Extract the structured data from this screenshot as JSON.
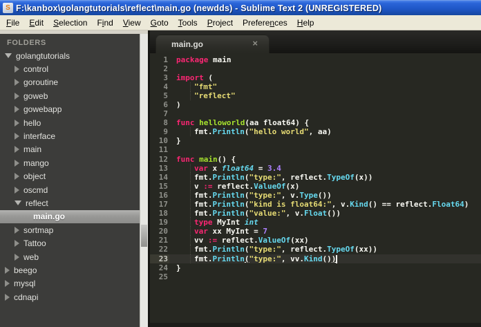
{
  "window": {
    "title": "F:\\kanbox\\golangtutorials\\reflect\\main.go (newdds) - Sublime Text 2 (UNREGISTERED)",
    "app_icon_glyph": "S"
  },
  "menu": {
    "items": [
      {
        "label": "File",
        "mnemonic_index": 0
      },
      {
        "label": "Edit",
        "mnemonic_index": 0
      },
      {
        "label": "Selection",
        "mnemonic_index": 0
      },
      {
        "label": "Find",
        "mnemonic_index": 1
      },
      {
        "label": "View",
        "mnemonic_index": 0
      },
      {
        "label": "Goto",
        "mnemonic_index": 0
      },
      {
        "label": "Tools",
        "mnemonic_index": 0
      },
      {
        "label": "Project",
        "mnemonic_index": 0
      },
      {
        "label": "Preferences",
        "mnemonic_index": 7
      },
      {
        "label": "Help",
        "mnemonic_index": 0
      }
    ]
  },
  "sidebar": {
    "header": "FOLDERS",
    "items": [
      {
        "label": "golangtutorials",
        "depth": 0,
        "state": "open",
        "selected": false
      },
      {
        "label": "control",
        "depth": 1,
        "state": "closed",
        "selected": false
      },
      {
        "label": "goroutine",
        "depth": 1,
        "state": "closed",
        "selected": false
      },
      {
        "label": "goweb",
        "depth": 1,
        "state": "closed",
        "selected": false
      },
      {
        "label": "gowebapp",
        "depth": 1,
        "state": "closed",
        "selected": false
      },
      {
        "label": "hello",
        "depth": 1,
        "state": "closed",
        "selected": false
      },
      {
        "label": "interface",
        "depth": 1,
        "state": "closed",
        "selected": false
      },
      {
        "label": "main",
        "depth": 1,
        "state": "closed",
        "selected": false
      },
      {
        "label": "mango",
        "depth": 1,
        "state": "closed",
        "selected": false
      },
      {
        "label": "object",
        "depth": 1,
        "state": "closed",
        "selected": false
      },
      {
        "label": "oscmd",
        "depth": 1,
        "state": "closed",
        "selected": false
      },
      {
        "label": "reflect",
        "depth": 1,
        "state": "open",
        "selected": false
      },
      {
        "label": "main.go",
        "depth": 2,
        "state": "file",
        "selected": true
      },
      {
        "label": "sortmap",
        "depth": 1,
        "state": "closed",
        "selected": false
      },
      {
        "label": "Tattoo",
        "depth": 1,
        "state": "closed",
        "selected": false
      },
      {
        "label": "web",
        "depth": 1,
        "state": "closed",
        "selected": false
      },
      {
        "label": "beego",
        "depth": 0,
        "state": "closed",
        "selected": false
      },
      {
        "label": "mysql",
        "depth": 0,
        "state": "closed",
        "selected": false
      },
      {
        "label": "cdnapi",
        "depth": 0,
        "state": "closed",
        "selected": false
      }
    ]
  },
  "tab_bar": {
    "tabs": [
      {
        "label": "main.go",
        "close_glyph": "×",
        "active": true
      }
    ]
  },
  "editor": {
    "language": "Go",
    "line_count": 25,
    "active_line": 23,
    "lines": [
      {
        "ind": 0,
        "tokens": [
          {
            "t": "package",
            "s": "k"
          },
          {
            "t": " main",
            "s": "p"
          }
        ]
      },
      {
        "ind": 0,
        "tokens": []
      },
      {
        "ind": 0,
        "tokens": [
          {
            "t": "import",
            "s": "k"
          },
          {
            "t": " (",
            "s": "p"
          }
        ]
      },
      {
        "ind": 1,
        "tokens": [
          {
            "t": "\"fmt\"",
            "s": "s"
          }
        ]
      },
      {
        "ind": 1,
        "tokens": [
          {
            "t": "\"reflect\"",
            "s": "s"
          }
        ]
      },
      {
        "ind": 0,
        "tokens": [
          {
            "t": ")",
            "s": "p"
          }
        ]
      },
      {
        "ind": 0,
        "tokens": []
      },
      {
        "ind": 0,
        "tokens": [
          {
            "t": "func",
            "s": "k"
          },
          {
            "t": " ",
            "s": "p"
          },
          {
            "t": "helloworld",
            "s": "f"
          },
          {
            "t": "(aa float64) {",
            "s": "p"
          }
        ]
      },
      {
        "ind": 1,
        "tokens": [
          {
            "t": "fmt.",
            "s": "p"
          },
          {
            "t": "Println",
            "s": "c"
          },
          {
            "t": "(",
            "s": "p"
          },
          {
            "t": "\"hello world\"",
            "s": "s"
          },
          {
            "t": ", aa)",
            "s": "p"
          }
        ]
      },
      {
        "ind": 0,
        "tokens": [
          {
            "t": "}",
            "s": "p"
          }
        ]
      },
      {
        "ind": 0,
        "tokens": []
      },
      {
        "ind": 0,
        "tokens": [
          {
            "t": "func",
            "s": "k"
          },
          {
            "t": " ",
            "s": "p"
          },
          {
            "t": "main",
            "s": "f"
          },
          {
            "t": "() {",
            "s": "p"
          }
        ]
      },
      {
        "ind": 1,
        "tokens": [
          {
            "t": "var",
            "s": "k"
          },
          {
            "t": " x ",
            "s": "p"
          },
          {
            "t": "float64",
            "s": "ci"
          },
          {
            "t": " = ",
            "s": "p"
          },
          {
            "t": "3.4",
            "s": "n"
          }
        ]
      },
      {
        "ind": 1,
        "tokens": [
          {
            "t": "fmt.",
            "s": "p"
          },
          {
            "t": "Println",
            "s": "c"
          },
          {
            "t": "(",
            "s": "p"
          },
          {
            "t": "\"type:\"",
            "s": "s"
          },
          {
            "t": ", reflect.",
            "s": "p"
          },
          {
            "t": "TypeOf",
            "s": "c"
          },
          {
            "t": "(x))",
            "s": "p"
          }
        ]
      },
      {
        "ind": 1,
        "tokens": [
          {
            "t": "v ",
            "s": "p"
          },
          {
            "t": ":=",
            "s": "k"
          },
          {
            "t": " reflect.",
            "s": "p"
          },
          {
            "t": "ValueOf",
            "s": "c"
          },
          {
            "t": "(x)",
            "s": "p"
          }
        ]
      },
      {
        "ind": 1,
        "tokens": [
          {
            "t": "fmt.",
            "s": "p"
          },
          {
            "t": "Println",
            "s": "c"
          },
          {
            "t": "(",
            "s": "p"
          },
          {
            "t": "\"type:\"",
            "s": "s"
          },
          {
            "t": ", v.",
            "s": "p"
          },
          {
            "t": "Type",
            "s": "c"
          },
          {
            "t": "())",
            "s": "p"
          }
        ]
      },
      {
        "ind": 1,
        "tokens": [
          {
            "t": "fmt.",
            "s": "p"
          },
          {
            "t": "Println",
            "s": "c"
          },
          {
            "t": "(",
            "s": "p"
          },
          {
            "t": "\"kind is float64:\"",
            "s": "s"
          },
          {
            "t": ", v.",
            "s": "p"
          },
          {
            "t": "Kind",
            "s": "c"
          },
          {
            "t": "() == reflect.",
            "s": "p"
          },
          {
            "t": "Float64",
            "s": "c"
          },
          {
            "t": ")",
            "s": "p"
          }
        ]
      },
      {
        "ind": 1,
        "tokens": [
          {
            "t": "fmt.",
            "s": "p"
          },
          {
            "t": "Println",
            "s": "c"
          },
          {
            "t": "(",
            "s": "p"
          },
          {
            "t": "\"value:\"",
            "s": "s"
          },
          {
            "t": ", v.",
            "s": "p"
          },
          {
            "t": "Float",
            "s": "c"
          },
          {
            "t": "())",
            "s": "p"
          }
        ]
      },
      {
        "ind": 1,
        "tokens": [
          {
            "t": "type",
            "s": "k"
          },
          {
            "t": " MyInt ",
            "s": "p"
          },
          {
            "t": "int",
            "s": "ci"
          }
        ]
      },
      {
        "ind": 1,
        "tokens": [
          {
            "t": "var",
            "s": "k"
          },
          {
            "t": " xx MyInt = ",
            "s": "p"
          },
          {
            "t": "7",
            "s": "n"
          }
        ]
      },
      {
        "ind": 1,
        "tokens": [
          {
            "t": "vv ",
            "s": "p"
          },
          {
            "t": ":=",
            "s": "k"
          },
          {
            "t": " reflect.",
            "s": "p"
          },
          {
            "t": "ValueOf",
            "s": "c"
          },
          {
            "t": "(xx)",
            "s": "p"
          }
        ]
      },
      {
        "ind": 1,
        "tokens": [
          {
            "t": "fmt.",
            "s": "p"
          },
          {
            "t": "Println",
            "s": "c"
          },
          {
            "t": "(",
            "s": "p"
          },
          {
            "t": "\"type:\"",
            "s": "s"
          },
          {
            "t": ", reflect.",
            "s": "p"
          },
          {
            "t": "TypeOf",
            "s": "c"
          },
          {
            "t": "(xx))",
            "s": "p"
          }
        ]
      },
      {
        "ind": 1,
        "caret": true,
        "tokens": [
          {
            "t": "fmt.",
            "s": "p"
          },
          {
            "t": "Println",
            "s": "c"
          },
          {
            "t": "(",
            "s": "p",
            "u": true
          },
          {
            "t": "\"type:\"",
            "s": "s"
          },
          {
            "t": ", vv.",
            "s": "p"
          },
          {
            "t": "Kind",
            "s": "c"
          },
          {
            "t": "()",
            "s": "p"
          },
          {
            "t": ")",
            "s": "p",
            "u": true
          }
        ]
      },
      {
        "ind": 0,
        "tokens": [
          {
            "t": "}",
            "s": "p"
          }
        ]
      },
      {
        "ind": 0,
        "tokens": []
      }
    ]
  },
  "colors": {
    "titlebar_blue": "#1f57c8",
    "menubar_bg": "#ece9d8",
    "sidebar_bg": "#3c3c3a",
    "editor_bg": "#272822",
    "keyword": "#f92672",
    "string": "#e6db74",
    "function_def": "#a6e22e",
    "support_call": "#66d9ef",
    "number": "#ae81ff",
    "foreground": "#f8f8f2",
    "line_number": "#8f908a"
  }
}
